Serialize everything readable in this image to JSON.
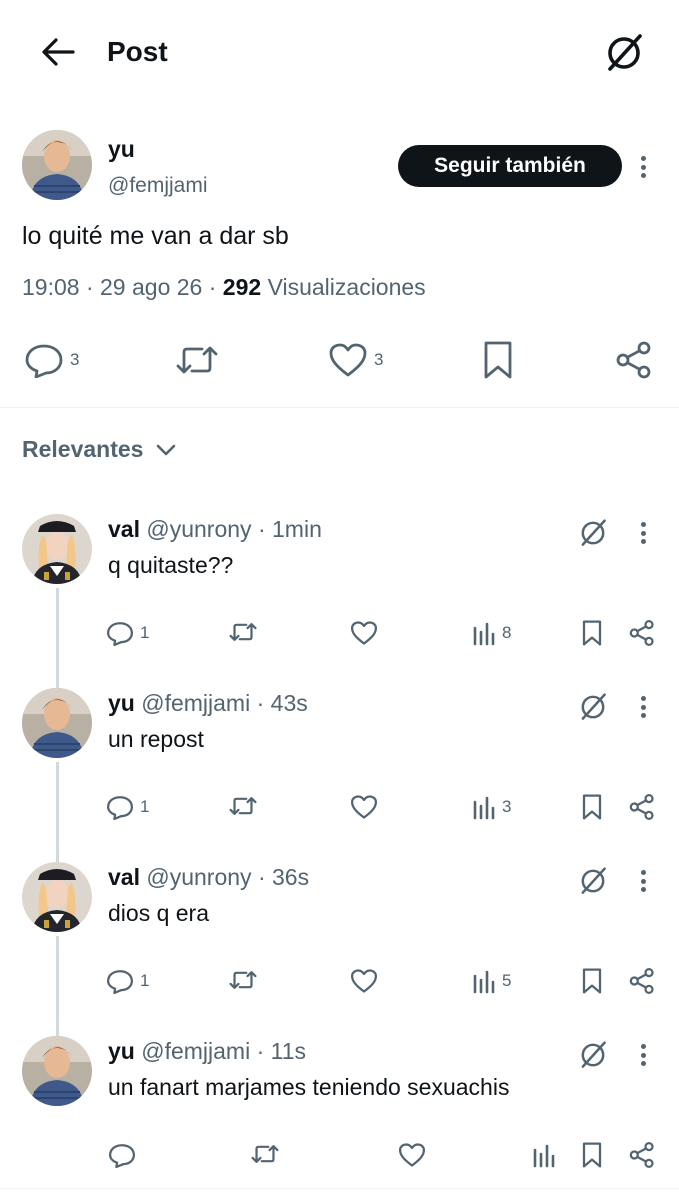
{
  "header": {
    "title": "Post"
  },
  "post": {
    "name": "yu",
    "handle": "@femjjami",
    "follow_label": "Seguir también",
    "text": "lo quité me van a dar sb",
    "time": "19:08",
    "date": "29 ago 26",
    "views": "292",
    "views_label": "Visualizaciones",
    "replies": "3",
    "likes": "3"
  },
  "sort": {
    "label": "Relevantes"
  },
  "replies": [
    {
      "name": "val",
      "handle": "@yunrony",
      "time": "1min",
      "text": "q quitaste??",
      "replies": "1",
      "views": "8",
      "avatar": "val"
    },
    {
      "name": "yu",
      "handle": "@femjjami",
      "time": "43s",
      "text": "un repost",
      "replies": "1",
      "views": "3",
      "avatar": "yu"
    },
    {
      "name": "val",
      "handle": "@yunrony",
      "time": "36s",
      "text": "dios q era",
      "replies": "1",
      "views": "5",
      "avatar": "val"
    },
    {
      "name": "yu",
      "handle": "@femjjami",
      "time": "11s",
      "text": "un fanart marjames teniendo sexuachis",
      "replies": "",
      "views": "",
      "avatar": "yu"
    }
  ],
  "colors": {
    "text": "#0f1419",
    "secondary": "#536471",
    "thread": "#cfd9de"
  }
}
